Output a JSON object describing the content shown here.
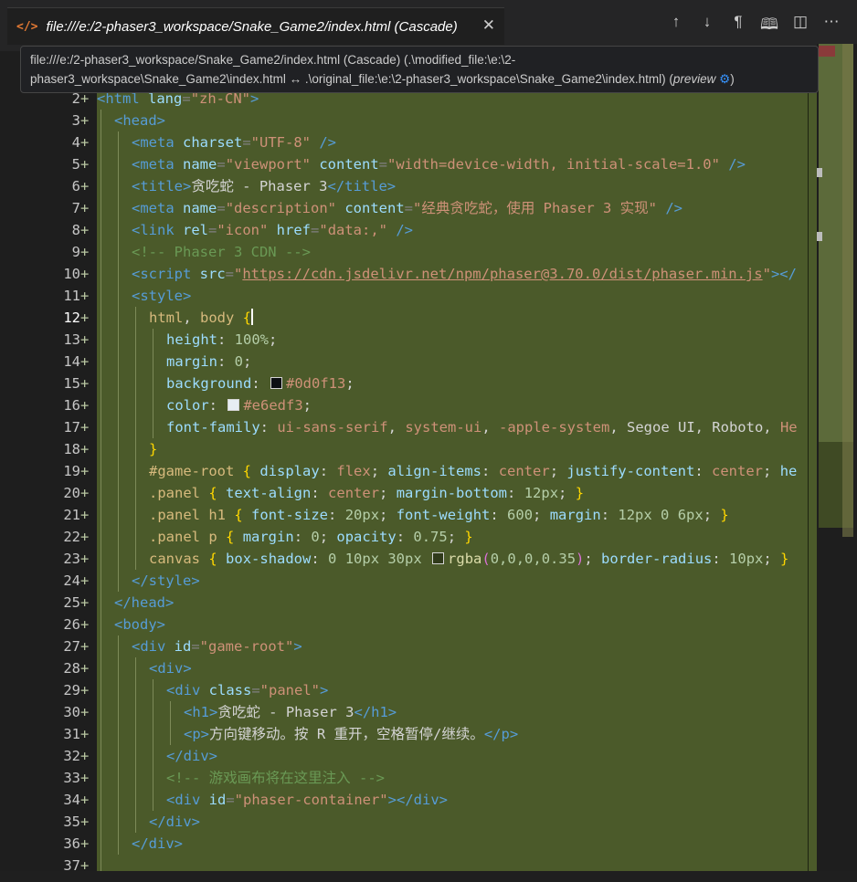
{
  "tab": {
    "icon": "</>",
    "title": "file:///e:/2-phaser3_workspace/Snake_Game2/index.html (Cascade)",
    "close": "✕"
  },
  "actions": [
    {
      "name": "previous-change-icon",
      "glyph": "↑"
    },
    {
      "name": "next-change-icon",
      "glyph": "↓"
    },
    {
      "name": "show-whitespace-icon",
      "glyph": "¶"
    },
    {
      "name": "open-preview-icon",
      "glyph": "🕮"
    },
    {
      "name": "split-editor-icon",
      "glyph": "◫"
    },
    {
      "name": "more-actions-icon",
      "glyph": "⋯"
    }
  ],
  "tooltip": {
    "line1": "file:///e:/2-phaser3_workspace/Snake_Game2/index.html (Cascade) (.\\modified_file:\\e:\\2-",
    "line2": "phaser3_workspace\\Snake_Game2\\index.html ↔ .\\original_file:\\e:\\2-phaser3_workspace\\Snake_Game2\\index.html) (",
    "preview": "preview",
    "gear": "⚙",
    "end": ")"
  },
  "editor": {
    "current_line": "12",
    "lines": [
      {
        "n": "2",
        "indent": 0,
        "t": [
          [
            "tag",
            "<html"
          ],
          [
            "att",
            " lang"
          ],
          [
            "punc",
            "="
          ],
          [
            "str",
            "\"zh-CN\""
          ],
          [
            "tag",
            ">"
          ]
        ]
      },
      {
        "n": "3",
        "indent": 1,
        "t": [
          [
            "tag",
            "<head>"
          ]
        ]
      },
      {
        "n": "4",
        "indent": 2,
        "t": [
          [
            "tag",
            "<meta"
          ],
          [
            "att",
            " charset"
          ],
          [
            "punc",
            "="
          ],
          [
            "str",
            "\"UTF-8\""
          ],
          [
            "tag",
            " />"
          ]
        ]
      },
      {
        "n": "5",
        "indent": 2,
        "t": [
          [
            "tag",
            "<meta"
          ],
          [
            "att",
            " name"
          ],
          [
            "punc",
            "="
          ],
          [
            "str",
            "\"viewport\""
          ],
          [
            "att",
            " content"
          ],
          [
            "punc",
            "="
          ],
          [
            "str",
            "\"width=device-width, initial-scale=1.0\""
          ],
          [
            "tag",
            " />"
          ]
        ]
      },
      {
        "n": "6",
        "indent": 2,
        "t": [
          [
            "tag",
            "<title>"
          ],
          [
            "plain",
            "贪吃蛇 - Phaser 3"
          ],
          [
            "tag",
            "</title>"
          ]
        ]
      },
      {
        "n": "7",
        "indent": 2,
        "t": [
          [
            "tag",
            "<meta"
          ],
          [
            "att",
            " name"
          ],
          [
            "punc",
            "="
          ],
          [
            "str",
            "\"description\""
          ],
          [
            "att",
            " content"
          ],
          [
            "punc",
            "="
          ],
          [
            "str",
            "\"经典贪吃蛇，使用 Phaser 3 实现\""
          ],
          [
            "tag",
            " />"
          ]
        ]
      },
      {
        "n": "8",
        "indent": 2,
        "t": [
          [
            "tag",
            "<link"
          ],
          [
            "att",
            " rel"
          ],
          [
            "punc",
            "="
          ],
          [
            "str",
            "\"icon\""
          ],
          [
            "att",
            " href"
          ],
          [
            "punc",
            "="
          ],
          [
            "str",
            "\"data:,\""
          ],
          [
            "tag",
            " />"
          ]
        ]
      },
      {
        "n": "9",
        "indent": 2,
        "t": [
          [
            "cmt",
            "<!-- Phaser 3 CDN -->"
          ]
        ]
      },
      {
        "n": "10",
        "indent": 2,
        "t": [
          [
            "tag",
            "<script"
          ],
          [
            "att",
            " src"
          ],
          [
            "punc",
            "="
          ],
          [
            "str",
            "\""
          ],
          [
            "link",
            "https://cdn.jsdelivr.net/npm/phaser@3.70.0/dist/phaser.min.js"
          ],
          [
            "str",
            "\""
          ],
          [
            "tag",
            "></"
          ]
        ]
      },
      {
        "n": "11",
        "indent": 2,
        "t": [
          [
            "tag",
            "<style>"
          ]
        ]
      },
      {
        "n": "12",
        "indent": 3,
        "t": [
          [
            "sel",
            "html"
          ],
          [
            "plain",
            ", "
          ],
          [
            "sel",
            "body"
          ],
          [
            "plain",
            " "
          ],
          [
            "br",
            "{"
          ],
          [
            "cursor",
            ""
          ]
        ]
      },
      {
        "n": "13",
        "indent": 4,
        "t": [
          [
            "prop",
            "height"
          ],
          [
            "plain",
            ": "
          ],
          [
            "num",
            "100%"
          ],
          [
            "plain",
            ";"
          ]
        ]
      },
      {
        "n": "14",
        "indent": 4,
        "t": [
          [
            "prop",
            "margin"
          ],
          [
            "plain",
            ": "
          ],
          [
            "num",
            "0"
          ],
          [
            "plain",
            ";"
          ]
        ]
      },
      {
        "n": "15",
        "indent": 4,
        "t": [
          [
            "prop",
            "background"
          ],
          [
            "plain",
            ": "
          ],
          [
            "swatch",
            "#0d0f13"
          ],
          [
            "val",
            "#0d0f13"
          ],
          [
            "plain",
            ";"
          ]
        ]
      },
      {
        "n": "16",
        "indent": 4,
        "t": [
          [
            "prop",
            "color"
          ],
          [
            "plain",
            ": "
          ],
          [
            "swatch",
            "#e6edf3"
          ],
          [
            "val",
            "#e6edf3"
          ],
          [
            "plain",
            ";"
          ]
        ]
      },
      {
        "n": "17",
        "indent": 4,
        "t": [
          [
            "prop",
            "font-family"
          ],
          [
            "plain",
            ": "
          ],
          [
            "val",
            "ui-sans-serif"
          ],
          [
            "plain",
            ", "
          ],
          [
            "val",
            "system-ui"
          ],
          [
            "plain",
            ", "
          ],
          [
            "val",
            "-apple-system"
          ],
          [
            "plain",
            ", Segoe UI, Roboto, "
          ],
          [
            "val",
            "He"
          ]
        ]
      },
      {
        "n": "18",
        "indent": 3,
        "t": [
          [
            "br",
            "}"
          ]
        ]
      },
      {
        "n": "19",
        "indent": 3,
        "t": [
          [
            "sel",
            "#game-root"
          ],
          [
            "plain",
            " "
          ],
          [
            "br",
            "{"
          ],
          [
            "plain",
            " "
          ],
          [
            "prop",
            "display"
          ],
          [
            "plain",
            ": "
          ],
          [
            "val",
            "flex"
          ],
          [
            "plain",
            "; "
          ],
          [
            "prop",
            "align-items"
          ],
          [
            "plain",
            ": "
          ],
          [
            "val",
            "center"
          ],
          [
            "plain",
            "; "
          ],
          [
            "prop",
            "justify-content"
          ],
          [
            "plain",
            ": "
          ],
          [
            "val",
            "center"
          ],
          [
            "plain",
            "; "
          ],
          [
            "prop",
            "he"
          ]
        ]
      },
      {
        "n": "20",
        "indent": 3,
        "t": [
          [
            "sel",
            ".panel"
          ],
          [
            "plain",
            " "
          ],
          [
            "br",
            "{"
          ],
          [
            "plain",
            " "
          ],
          [
            "prop",
            "text-align"
          ],
          [
            "plain",
            ": "
          ],
          [
            "val",
            "center"
          ],
          [
            "plain",
            "; "
          ],
          [
            "prop",
            "margin-bottom"
          ],
          [
            "plain",
            ": "
          ],
          [
            "num",
            "12px"
          ],
          [
            "plain",
            "; "
          ],
          [
            "br",
            "}"
          ]
        ]
      },
      {
        "n": "21",
        "indent": 3,
        "t": [
          [
            "sel",
            ".panel h1"
          ],
          [
            "plain",
            " "
          ],
          [
            "br",
            "{"
          ],
          [
            "plain",
            " "
          ],
          [
            "prop",
            "font-size"
          ],
          [
            "plain",
            ": "
          ],
          [
            "num",
            "20px"
          ],
          [
            "plain",
            "; "
          ],
          [
            "prop",
            "font-weight"
          ],
          [
            "plain",
            ": "
          ],
          [
            "num",
            "600"
          ],
          [
            "plain",
            "; "
          ],
          [
            "prop",
            "margin"
          ],
          [
            "plain",
            ": "
          ],
          [
            "num",
            "12px 0 6px"
          ],
          [
            "plain",
            "; "
          ],
          [
            "br",
            "}"
          ]
        ]
      },
      {
        "n": "22",
        "indent": 3,
        "t": [
          [
            "sel",
            ".panel p"
          ],
          [
            "plain",
            " "
          ],
          [
            "br",
            "{"
          ],
          [
            "plain",
            " "
          ],
          [
            "prop",
            "margin"
          ],
          [
            "plain",
            ": "
          ],
          [
            "num",
            "0"
          ],
          [
            "plain",
            "; "
          ],
          [
            "prop",
            "opacity"
          ],
          [
            "plain",
            ": "
          ],
          [
            "num",
            "0.75"
          ],
          [
            "plain",
            "; "
          ],
          [
            "br",
            "}"
          ]
        ]
      },
      {
        "n": "23",
        "indent": 3,
        "t": [
          [
            "sel",
            "canvas"
          ],
          [
            "plain",
            " "
          ],
          [
            "br",
            "{"
          ],
          [
            "plain",
            " "
          ],
          [
            "prop",
            "box-shadow"
          ],
          [
            "plain",
            ": "
          ],
          [
            "num",
            "0 10px 30px"
          ],
          [
            "plain",
            " "
          ],
          [
            "swatch",
            "rgba(0,0,0,0.35)"
          ],
          [
            "fn",
            "rgba"
          ],
          [
            "br2",
            "("
          ],
          [
            "num",
            "0,0,0,0.35"
          ],
          [
            "br2",
            ")"
          ],
          [
            "plain",
            "; "
          ],
          [
            "prop",
            "border-radius"
          ],
          [
            "plain",
            ": "
          ],
          [
            "num",
            "10px"
          ],
          [
            "plain",
            "; "
          ],
          [
            "br",
            "}"
          ]
        ]
      },
      {
        "n": "24",
        "indent": 2,
        "t": [
          [
            "tag",
            "</style>"
          ]
        ]
      },
      {
        "n": "25",
        "indent": 1,
        "t": [
          [
            "tag",
            "</head>"
          ]
        ]
      },
      {
        "n": "26",
        "indent": 1,
        "t": [
          [
            "tag",
            "<body>"
          ]
        ]
      },
      {
        "n": "27",
        "indent": 2,
        "t": [
          [
            "tag",
            "<div"
          ],
          [
            "att",
            " id"
          ],
          [
            "punc",
            "="
          ],
          [
            "str",
            "\"game-root\""
          ],
          [
            "tag",
            ">"
          ]
        ]
      },
      {
        "n": "28",
        "indent": 3,
        "t": [
          [
            "tag",
            "<div>"
          ]
        ]
      },
      {
        "n": "29",
        "indent": 4,
        "t": [
          [
            "tag",
            "<div"
          ],
          [
            "att",
            " class"
          ],
          [
            "punc",
            "="
          ],
          [
            "str",
            "\"panel\""
          ],
          [
            "tag",
            ">"
          ]
        ]
      },
      {
        "n": "30",
        "indent": 5,
        "t": [
          [
            "tag",
            "<h1>"
          ],
          [
            "plain",
            "贪吃蛇 - Phaser 3"
          ],
          [
            "tag",
            "</h1>"
          ]
        ]
      },
      {
        "n": "31",
        "indent": 5,
        "t": [
          [
            "tag",
            "<p>"
          ],
          [
            "plain",
            "方向键移动。按 R 重开，空格暂停/继续。"
          ],
          [
            "tag",
            "</p>"
          ]
        ]
      },
      {
        "n": "32",
        "indent": 4,
        "t": [
          [
            "tag",
            "</div>"
          ]
        ]
      },
      {
        "n": "33",
        "indent": 4,
        "t": [
          [
            "cmt",
            "<!-- 游戏画布将在这里注入 -->"
          ]
        ]
      },
      {
        "n": "34",
        "indent": 4,
        "t": [
          [
            "tag",
            "<div"
          ],
          [
            "att",
            " id"
          ],
          [
            "punc",
            "="
          ],
          [
            "str",
            "\"phaser-container\""
          ],
          [
            "tag",
            "></div>"
          ]
        ]
      },
      {
        "n": "35",
        "indent": 3,
        "t": [
          [
            "tag",
            "</div>"
          ]
        ]
      },
      {
        "n": "36",
        "indent": 2,
        "t": [
          [
            "tag",
            "</div>"
          ]
        ]
      },
      {
        "n": "37",
        "indent": 1,
        "t": []
      }
    ],
    "plus_marker": "+"
  },
  "colors": {
    "code_background": "#4b5a2a",
    "tab_icon": "#e37933",
    "editor_background": "#1e1e1e"
  }
}
